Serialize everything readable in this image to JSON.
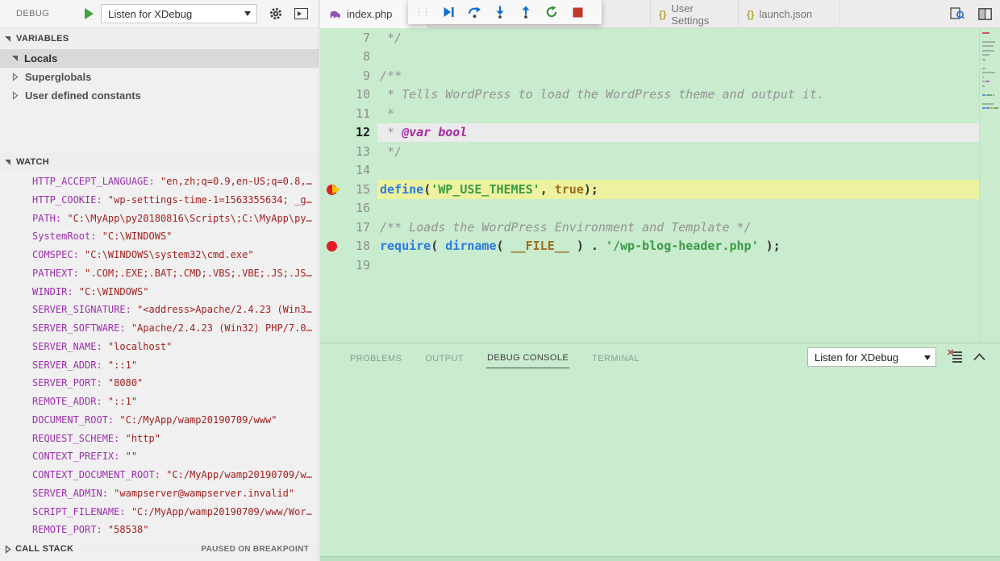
{
  "colors": {
    "editor_bg": "#c9ebce",
    "exec_line_highlight": "#edf2a0",
    "cursor_line_highlight": "#ebebeb",
    "keyword": "#2a7ae2",
    "string": "#3c9b46",
    "literal": "#9c6d1e",
    "comment": "#949494",
    "annotation": "#a626a4",
    "watch_key": "#9c2fae",
    "watch_value": "#a32020",
    "breakpoint": "#e51b24",
    "exec_arrow": "#f2c500",
    "stop_red": "#c0392b",
    "restart_green": "#388e3c",
    "step_blue": "#0e6fd1",
    "start_green": "#3fa33f"
  },
  "debug_header": {
    "title": "DEBUG",
    "config_dropdown": "Listen for XDebug",
    "icons": [
      "start-debug",
      "gear",
      "debug-console-toggle"
    ]
  },
  "sidebar": {
    "variables": {
      "header": "VARIABLES",
      "items": [
        {
          "label": "Locals",
          "expanded": true,
          "selected": true
        },
        {
          "label": "Superglobals",
          "expanded": false
        },
        {
          "label": "User defined constants",
          "expanded": false
        }
      ]
    },
    "watch": {
      "header": "WATCH",
      "items": [
        {
          "key": "HTTP_ACCEPT_LANGUAGE",
          "value": "\"en,zh;q=0.9,en-US;q=0.8,…"
        },
        {
          "key": "HTTP_COOKIE",
          "value": "\"wp-settings-time-1=1563355634; _g…"
        },
        {
          "key": "PATH",
          "value": "\"C:\\MyApp\\py20180816\\Scripts\\;C:\\MyApp\\py…"
        },
        {
          "key": "SystemRoot",
          "value": "\"C:\\WINDOWS\""
        },
        {
          "key": "COMSPEC",
          "value": "\"C:\\WINDOWS\\system32\\cmd.exe\""
        },
        {
          "key": "PATHEXT",
          "value": "\".COM;.EXE;.BAT;.CMD;.VBS;.VBE;.JS;.JS…"
        },
        {
          "key": "WINDIR",
          "value": "\"C:\\WINDOWS\""
        },
        {
          "key": "SERVER_SIGNATURE",
          "value": "\"<address>Apache/2.4.23 (Win3…"
        },
        {
          "key": "SERVER_SOFTWARE",
          "value": "\"Apache/2.4.23 (Win32) PHP/7.0…"
        },
        {
          "key": "SERVER_NAME",
          "value": "\"localhost\""
        },
        {
          "key": "SERVER_ADDR",
          "value": "\"::1\""
        },
        {
          "key": "SERVER_PORT",
          "value": "\"8080\""
        },
        {
          "key": "REMOTE_ADDR",
          "value": "\"::1\""
        },
        {
          "key": "DOCUMENT_ROOT",
          "value": "\"C:/MyApp/wamp20190709/www\""
        },
        {
          "key": "REQUEST_SCHEME",
          "value": "\"http\""
        },
        {
          "key": "CONTEXT_PREFIX",
          "value": "\"\""
        },
        {
          "key": "CONTEXT_DOCUMENT_ROOT",
          "value": "\"C:/MyApp/wamp20190709/w…"
        },
        {
          "key": "SERVER_ADMIN",
          "value": "\"wampserver@wampserver.invalid\""
        },
        {
          "key": "SCRIPT_FILENAME",
          "value": "\"C:/MyApp/wamp20190709/www/Wor…"
        },
        {
          "key": "REMOTE_PORT",
          "value": "\"58538\""
        }
      ]
    },
    "call_stack": {
      "header": "CALL STACK",
      "status": "PAUSED ON BREAKPOINT"
    }
  },
  "editor_tabs": {
    "0": {
      "label": "index.php",
      "icon": "php-elephant",
      "active": true,
      "close": "×"
    },
    "1": {
      "label": "User Settings",
      "icon": "braces",
      "braces": "{}"
    },
    "2": {
      "label": "launch.json",
      "icon": "braces",
      "braces": "{}"
    }
  },
  "editor_actions": [
    "open-preview",
    "split-editor"
  ],
  "debug_toolbar": {
    "buttons": [
      "drag-grip",
      "continue",
      "step-over",
      "step-into",
      "step-out",
      "restart",
      "stop"
    ]
  },
  "editor": {
    "language": "php",
    "lines": [
      {
        "num": 7,
        "tokens": [
          {
            "t": " */",
            "c": "cmt"
          }
        ]
      },
      {
        "num": 8,
        "tokens": []
      },
      {
        "num": 9,
        "tokens": [
          {
            "t": "/**",
            "c": "cmt"
          }
        ]
      },
      {
        "num": 10,
        "tokens": [
          {
            "t": " * Tells WordPress to load the WordPress theme and output it.",
            "c": "cmt"
          }
        ]
      },
      {
        "num": 11,
        "tokens": [
          {
            "t": " *",
            "c": "cmt"
          }
        ]
      },
      {
        "num": 12,
        "hl": "current",
        "tokens": [
          {
            "t": " * ",
            "c": "cmt"
          },
          {
            "t": "@var",
            "c": "ann"
          },
          {
            "t": " ",
            "c": "cmt"
          },
          {
            "t": "bool",
            "c": "ann"
          }
        ]
      },
      {
        "num": 13,
        "tokens": [
          {
            "t": " */",
            "c": "cmt"
          }
        ]
      },
      {
        "num": 14,
        "tokens": []
      },
      {
        "num": 15,
        "hl": "exec",
        "bp": "active",
        "tokens": [
          {
            "t": "define",
            "c": "kw"
          },
          {
            "t": "(",
            "c": "pln"
          },
          {
            "t": "'WP_USE_THEMES'",
            "c": "str"
          },
          {
            "t": ", ",
            "c": "pln"
          },
          {
            "t": "true",
            "c": "lit"
          },
          {
            "t": ");",
            "c": "pln"
          }
        ]
      },
      {
        "num": 16,
        "tokens": []
      },
      {
        "num": 17,
        "tokens": [
          {
            "t": "/** Loads the WordPress Environment and Template */",
            "c": "cmt"
          }
        ]
      },
      {
        "num": 18,
        "bp": "plain",
        "tokens": [
          {
            "t": "require",
            "c": "kw"
          },
          {
            "t": "( ",
            "c": "pln"
          },
          {
            "t": "dirname",
            "c": "kw"
          },
          {
            "t": "( ",
            "c": "pln"
          },
          {
            "t": "__FILE__",
            "c": "lit"
          },
          {
            "t": " ) . ",
            "c": "pln"
          },
          {
            "t": "'/wp-blog-header.php'",
            "c": "str"
          },
          {
            "t": " );",
            "c": "pln"
          }
        ]
      },
      {
        "num": 19,
        "tokens": []
      }
    ]
  },
  "minimap": [
    [
      {
        "w": 9,
        "c": "red"
      }
    ],
    [],
    [
      {
        "w": 16,
        "c": "cmt"
      }
    ],
    [
      {
        "w": 14,
        "c": "cmt"
      }
    ],
    [
      {
        "w": 15,
        "c": "cmt"
      }
    ],
    [
      {
        "w": 9,
        "c": "cmt"
      }
    ],
    [
      {
        "w": 4,
        "c": "cmt"
      }
    ],
    [],
    [
      {
        "w": 4,
        "c": "cmt"
      }
    ],
    [
      {
        "w": 16,
        "c": "cmt"
      }
    ],
    [
      {
        "w": 2,
        "c": "cmt"
      }
    ],
    [
      {
        "w": 3,
        "c": "cmt"
      },
      {
        "w": 5,
        "c": "ann"
      }
    ],
    [
      {
        "w": 3,
        "c": "cmt"
      }
    ],
    [],
    [
      {
        "w": 4,
        "c": "kw"
      },
      {
        "w": 7,
        "c": "str"
      },
      {
        "w": 2,
        "c": "lit"
      }
    ],
    [],
    [
      {
        "w": 14,
        "c": "cmt"
      }
    ],
    [
      {
        "w": 4,
        "c": "kw"
      },
      {
        "w": 4,
        "c": "kw"
      },
      {
        "w": 3,
        "c": "lit"
      },
      {
        "w": 6,
        "c": "str"
      }
    ],
    []
  ],
  "panel": {
    "tabs": {
      "0": "PROBLEMS",
      "1": "OUTPUT",
      "2": "DEBUG CONSOLE",
      "3": "TERMINAL"
    },
    "active_tab": "DEBUG CONSOLE",
    "config_dropdown": "Listen for XDebug",
    "icons": [
      "clear-console",
      "collapse-panel"
    ]
  }
}
